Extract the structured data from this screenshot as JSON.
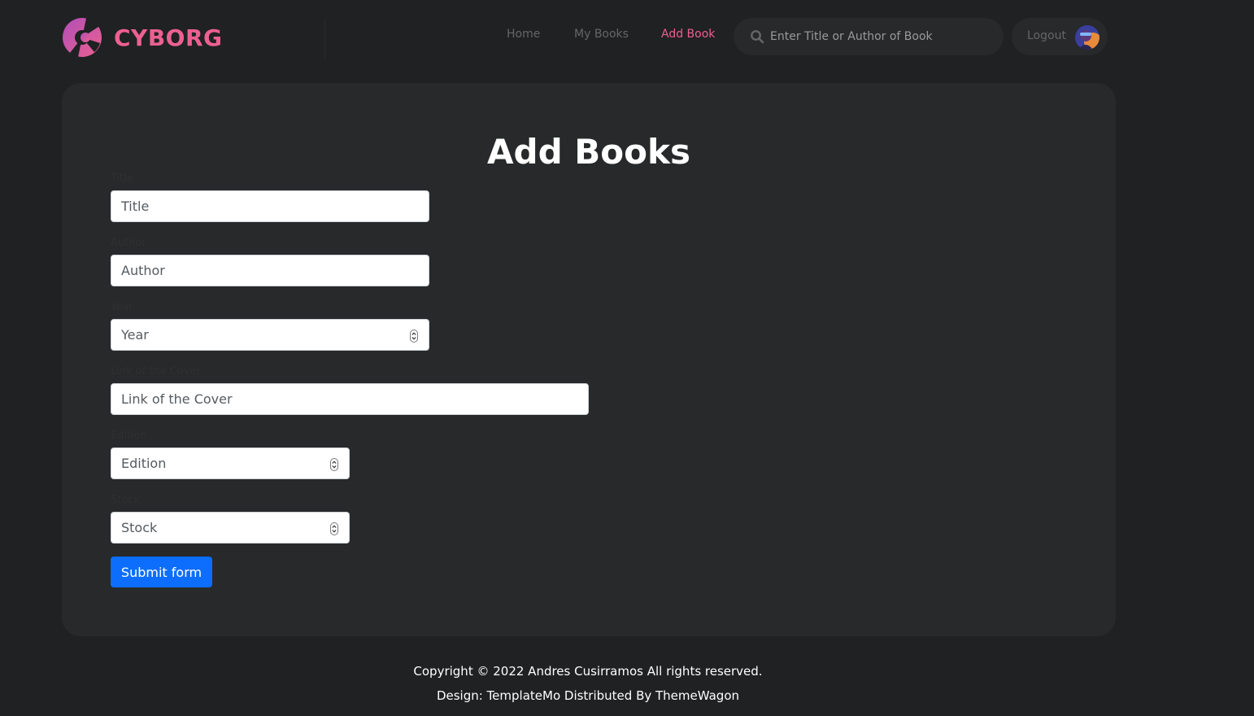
{
  "brand": {
    "name": "CYBORG",
    "accent_color": "#ec6090"
  },
  "nav": {
    "items": [
      {
        "label": "Home",
        "active": false
      },
      {
        "label": "My Books",
        "active": false
      },
      {
        "label": "Add Book",
        "active": true
      }
    ]
  },
  "search": {
    "placeholder": "Enter Title or Author of Book",
    "icon": "search-icon"
  },
  "account": {
    "logout_label": "Logout",
    "avatar_icon": "avatar"
  },
  "form": {
    "title": "Add Books",
    "fields": [
      {
        "label": "Title",
        "placeholder": "Title",
        "type": "text"
      },
      {
        "label": "Author",
        "placeholder": "Author",
        "type": "text"
      },
      {
        "label": "Year",
        "placeholder": "Year",
        "type": "number"
      },
      {
        "label": "Link of the Cover",
        "placeholder": "Link of the Cover",
        "type": "text"
      },
      {
        "label": "Edition",
        "placeholder": "Edition",
        "type": "number"
      },
      {
        "label": "Stock",
        "placeholder": "Stock",
        "type": "number"
      }
    ],
    "submit_label": "Submit form",
    "submit_color": "#0d6efd"
  },
  "footer": {
    "copyright": "Copyright © 2022 Andres Cusirramos All rights reserved.",
    "credits": "Design: TemplateMo Distributed By ThemeWagon"
  }
}
